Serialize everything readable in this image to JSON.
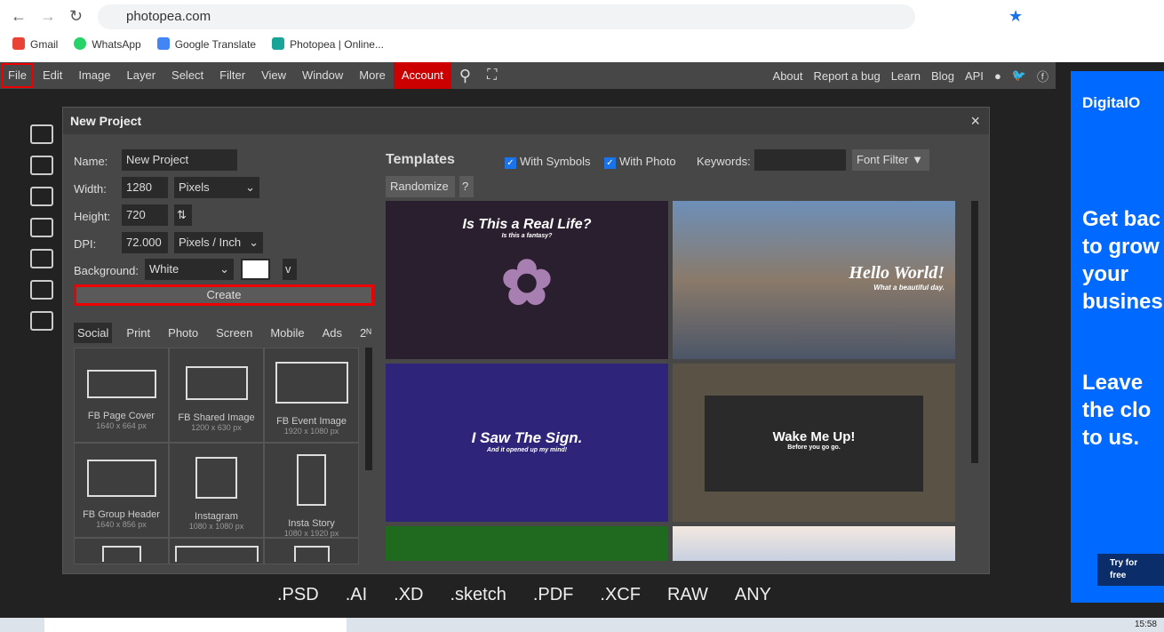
{
  "browser": {
    "url": "photopea.com",
    "bookmarks": [
      {
        "label": "Gmail",
        "color": "#ea4335"
      },
      {
        "label": "WhatsApp",
        "color": "#25d366"
      },
      {
        "label": "Google Translate",
        "color": "#4285f4"
      },
      {
        "label": "Photopea | Online...",
        "color": "#18a497"
      }
    ]
  },
  "menu": {
    "items": [
      "File",
      "Edit",
      "Image",
      "Layer",
      "Select",
      "Filter",
      "View",
      "Window",
      "More"
    ],
    "account": "Account",
    "right": [
      "About",
      "Report a bug",
      "Learn",
      "Blog",
      "API"
    ]
  },
  "dialog": {
    "title": "New Project",
    "name_label": "Name:",
    "name_value": "New Project",
    "width_label": "Width:",
    "width_value": "1280",
    "width_unit": "Pixels",
    "height_label": "Height:",
    "height_value": "720",
    "dpi_label": "DPI:",
    "dpi_value": "72.000",
    "dpi_unit": "Pixels / Inch",
    "bg_label": "Background:",
    "bg_value": "White",
    "bg_color": "#ffffff",
    "v_label": "v",
    "create": "Create",
    "tabs": [
      "Social",
      "Print",
      "Photo",
      "Screen",
      "Mobile",
      "Ads",
      "2ᴺ"
    ],
    "presets": [
      {
        "name": "FB Page Cover",
        "size": "1640 x 664 px"
      },
      {
        "name": "FB Shared Image",
        "size": "1200 x 630 px"
      },
      {
        "name": "FB Event Image",
        "size": "1920 x 1080 px"
      },
      {
        "name": "FB Group Header",
        "size": "1640 x 856 px"
      },
      {
        "name": "Instagram",
        "size": "1080 x 1080 px"
      },
      {
        "name": "Insta Story",
        "size": "1080 x 1920 px"
      }
    ],
    "templates_title": "Templates",
    "with_symbols": "With Symbols",
    "with_photo": "With Photo",
    "keywords": "Keywords:",
    "font_filter": "Font Filter ▼",
    "randomize": "Randomize",
    "help": "?",
    "templates": [
      {
        "title": "Is This a Real Life?",
        "sub": "Is this a fantasy?",
        "bg": "#2a1f2e"
      },
      {
        "title": "Hello World!",
        "sub": "What a beautiful day.",
        "bg": "#5a6a80"
      },
      {
        "title": "I Saw The Sign.",
        "sub": "And it opened up my mind!",
        "bg": "#2e2479"
      },
      {
        "title": "Wake Me Up!",
        "sub": "Before you go go.",
        "bg": "#4a4438"
      }
    ]
  },
  "formats": [
    ".PSD",
    ".AI",
    ".XD",
    ".sketch",
    ".PDF",
    ".XCF",
    "RAW",
    "ANY"
  ],
  "ad": {
    "brand": "DigitalO",
    "text1": "Get bac to grow your busines",
    "text2": "Leave the clo to us.",
    "cta": "Try for free"
  },
  "taskbar": {
    "time": "15:58"
  }
}
